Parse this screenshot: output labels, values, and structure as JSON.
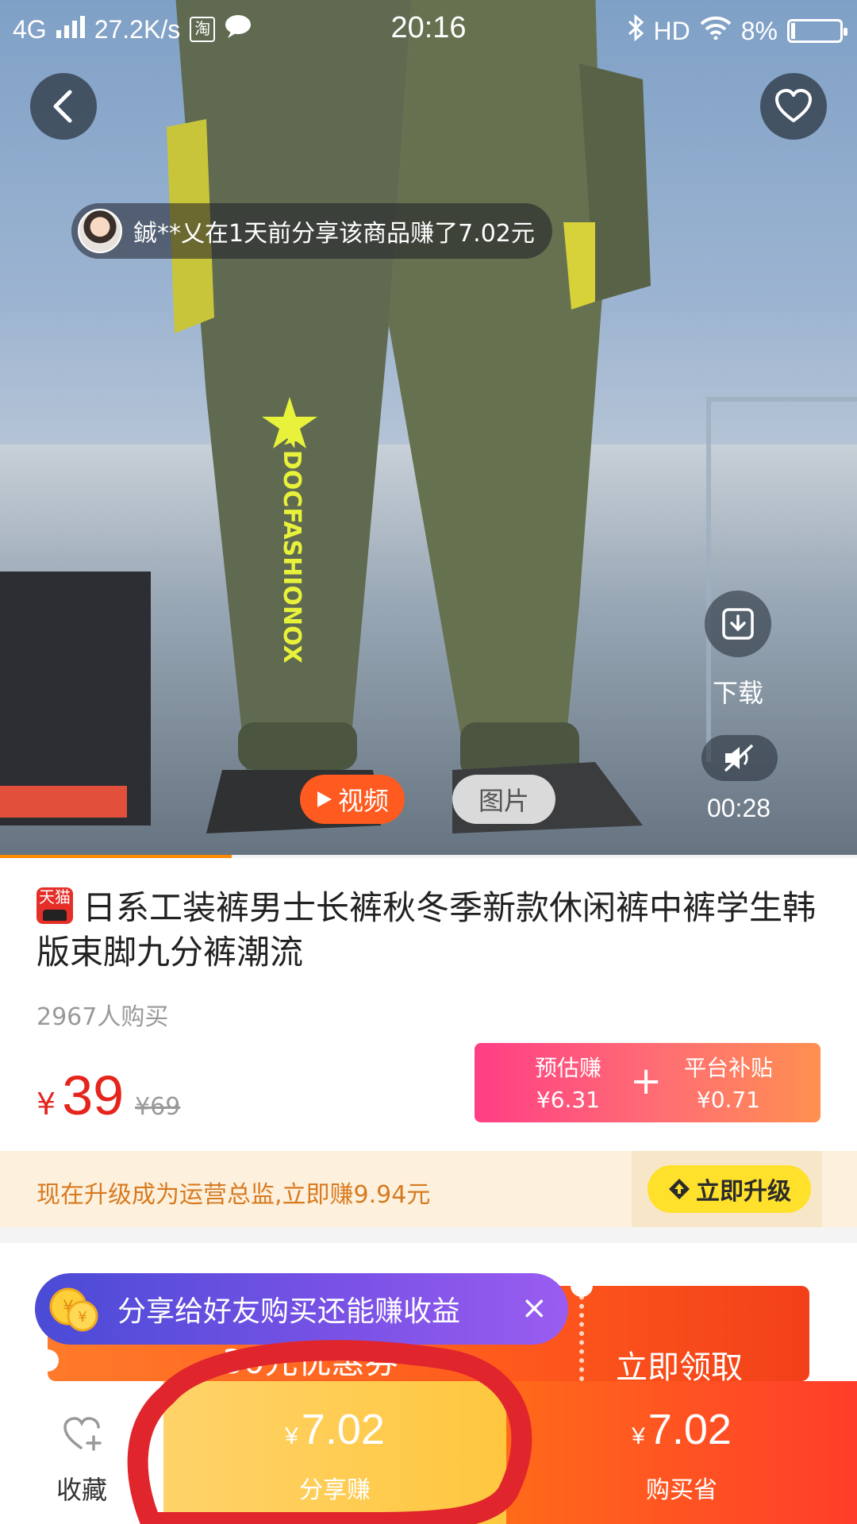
{
  "status_bar": {
    "network": "4G",
    "speed": "27.2K/s",
    "taobao_glyph": "淘",
    "time": "20:16",
    "hd": "HD",
    "battery_text": "8%",
    "battery_level": 0.08
  },
  "header": {
    "back_icon": "chevron-left-icon",
    "favorite_icon": "heart-icon"
  },
  "share_notice": {
    "text": "鋮**乂在1天前分享该商品赚了7.02元"
  },
  "media": {
    "download_label": "下载",
    "video_time": "00:28",
    "tab_video": "视频",
    "tab_image": "图片",
    "progress": 0.27,
    "watermark_text": "★DOCFASHIONOX"
  },
  "product": {
    "badge": "天猫",
    "title": "日系工装裤男士长裤秋冬季新款休闲裤中裤学生韩版束脚九分裤潮流",
    "sales": "2967人购买",
    "currency": "¥",
    "price": "39",
    "original_price": "¥69"
  },
  "earnings": {
    "estimated_label": "预估赚",
    "estimated_value": "¥6.31",
    "plus": "+",
    "subsidy_label": "平台补贴",
    "subsidy_value": "¥0.71"
  },
  "upgrade": {
    "text": "现在升级成为运营总监,立即赚9.94元",
    "button": "立即升级"
  },
  "coupon": {
    "amount_partial": "30元优惠券",
    "claim": "立即领取"
  },
  "share_tip": {
    "text": "分享给好友购买还能赚收益",
    "close": "×"
  },
  "bottom_bar": {
    "collect_label": "收藏",
    "share_currency": "¥",
    "share_amount": "7.02",
    "share_label": "分享赚",
    "buy_currency": "¥",
    "buy_amount": "7.02",
    "buy_label": "购买省"
  },
  "colors": {
    "price_red": "#e5241c",
    "video_tab": "#ff5a1f",
    "share_button": "#ffc73f",
    "buy_button": "#ff3d2a",
    "annotation_circle": "#e0262c"
  }
}
